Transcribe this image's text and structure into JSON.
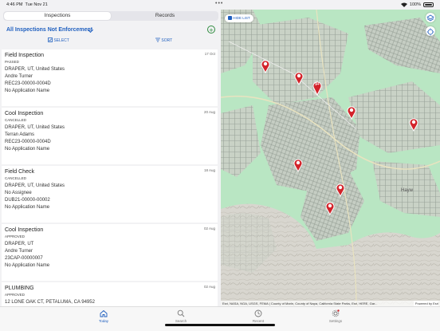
{
  "status_bar": {
    "time": "4:46 PM",
    "date": "Tue Nov 21",
    "battery": "100%"
  },
  "tabs": {
    "inspections": "Inspections",
    "records": "Records"
  },
  "filter": {
    "title": "All Inspections Not Enforcement"
  },
  "toolbar": {
    "select": "SELECT",
    "sort": "SORT"
  },
  "cards": [
    {
      "title": "Field Inspection",
      "status": "PASSED",
      "date": "17 Oct",
      "address": "DRAPER, UT, United States",
      "person": "Andre Turner",
      "record": "REC23-00000-0004D",
      "application": "No Application Name"
    },
    {
      "title": "Cool Inspection",
      "status": "CANCELLED",
      "date": "20 Aug",
      "address": "DRAPER, UT, United States",
      "person": "Terran Adams",
      "record": "REC23-00000-0004D",
      "application": "No Application Name"
    },
    {
      "title": "Field Check",
      "status": "CANCELLED",
      "date": "18 Aug",
      "address": "DRAPER, UT, United States",
      "person": "No Assignee",
      "record": "DUB21-00000-00002",
      "application": "No Application Name"
    },
    {
      "title": "Cool Inspection",
      "status": "APPROVED",
      "date": "02 Aug",
      "address": "DRAPER, UT",
      "person": "Andre Turner",
      "record": "23CAP-00000007",
      "application": "No Application Name"
    },
    {
      "title": "PLUMBING",
      "status": "APPROVED",
      "date": "02 Aug",
      "address": "12 LONE OAK CT, PETALUMA, CA 94952",
      "person": "",
      "record": "",
      "application": ""
    }
  ],
  "map": {
    "hide_list": "HIDE LIST",
    "cluster_count": "9+",
    "attribution": "Esri, NASA, NGA, USGS, FEMA | County of Marin, County of Napa, California State Parks, Esri, HERE, Gar...",
    "powered_by": "Powered by Esri",
    "place_label": "Hayw"
  },
  "tabbar": {
    "today": "Today",
    "search": "Search",
    "recent": "Recent",
    "settings": "Settings"
  },
  "colors": {
    "accent": "#1f5fbf",
    "pin": "#d2232a",
    "map_green": "#b9e6c3"
  }
}
